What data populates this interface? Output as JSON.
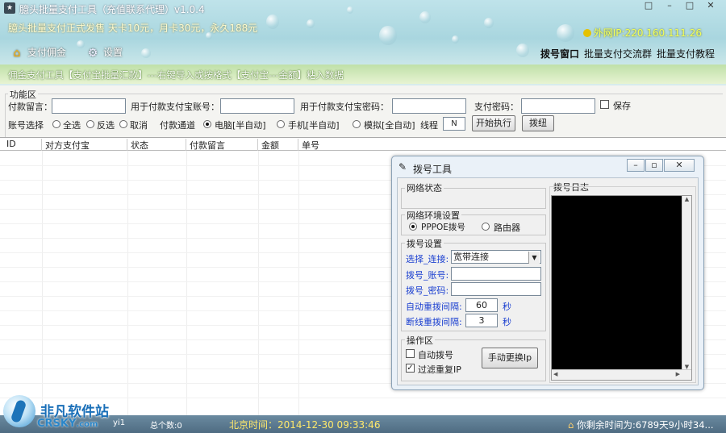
{
  "window": {
    "title": "臆头批量支付工具（充值联系代理）v1.0.4",
    "controls": [
      "□",
      "–",
      "□",
      "✕"
    ]
  },
  "header": {
    "promo": "臆头批量支付正式发售 天卡10元，月卡30元，永久188元",
    "ip_label": "外网IP:220.160.111.26",
    "nav_left": [
      {
        "label": "支付佣金",
        "icon": "home-icon"
      },
      {
        "label": "设置",
        "icon": "gear-icon"
      }
    ],
    "nav_right": [
      {
        "label": "拨号窗口"
      },
      {
        "label": "批量支付交流群"
      },
      {
        "label": "批量支付教程"
      }
    ],
    "notice": "佣金支付工具【支付宝批量汇款】---右键导入或按格式【支付宝---金额】粘入数据"
  },
  "func": {
    "legend": "功能区",
    "msg_label": "付款留言：",
    "account_label": "用于付款支付宝账号：",
    "pwd_label": "用于付款支付宝密码：",
    "paypwd_label": "支付密码：",
    "save_label": "保存",
    "select_label": "账号选择",
    "select_all": "全选",
    "invert": "反选",
    "cancel": "取消",
    "channel_label": "付款通道",
    "ch_pc": "电脑[半自动]",
    "ch_phone": "手机[半自动]",
    "ch_sim": "模拟[全自动]",
    "thread_label": "线程",
    "thread_value": "N",
    "start_btn": "开始执行",
    "dial_btn": "拨纽"
  },
  "table": {
    "columns": [
      "ID",
      "对方支付宝",
      "状态",
      "付款留言",
      "金额",
      "单号"
    ]
  },
  "dialog": {
    "title": "拨号工具",
    "net_status": "网络状态",
    "net_env": "网络环境设置",
    "opt_pppoe": "PPPOE拨号",
    "opt_router": "路由器",
    "dial_settings": "拨号设置",
    "conn_label": "选择_连接:",
    "conn_value": "宽带连接",
    "acct_label": "拨号_账号:",
    "pwd_label": "拨号_密码:",
    "auto_label": "自动重拨间隔:",
    "auto_value": "60",
    "disc_label": "断线重拨间隔:",
    "disc_value": "3",
    "unit": "秒",
    "op_area": "操作区",
    "auto_dial": "自动拨号",
    "filter_ip": "过滤重复IP",
    "change_ip": "手动更换Ip",
    "log_title": "拨号日志"
  },
  "status": {
    "user": "yi1",
    "total": "总个数:0",
    "time": "北京时间：2014-12-30 09:33:46",
    "remaining": "你剩余时间为:6789天9小时34..."
  },
  "logo": {
    "cn": "非凡软件站",
    "en": "CRSKY",
    "en_suffix": ".com"
  }
}
